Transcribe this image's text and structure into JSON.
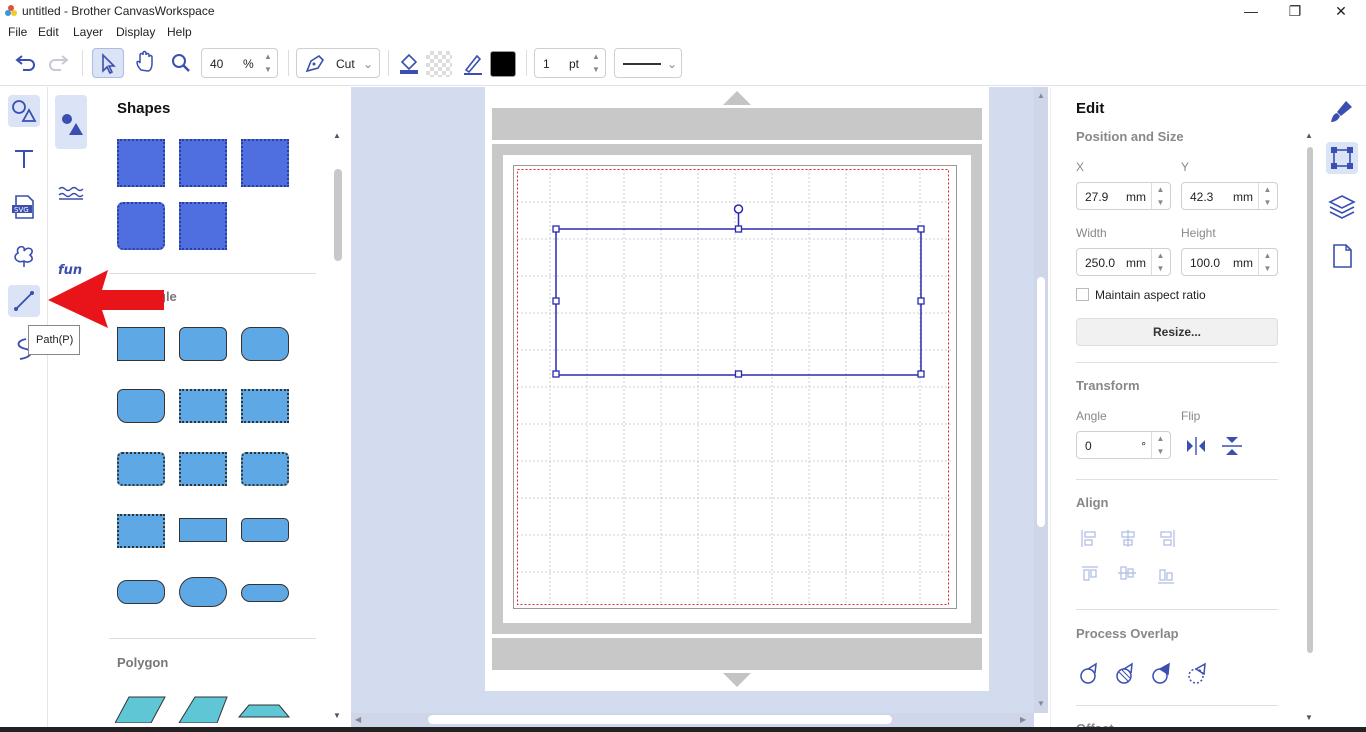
{
  "window": {
    "title": "untitled - Brother CanvasWorkspace"
  },
  "menu": [
    "File",
    "Edit",
    "Layer",
    "Display",
    "Help"
  ],
  "toolbar": {
    "zoom_value": "40",
    "zoom_unit": "%",
    "mode_label": "Cut",
    "stroke_width": "1",
    "stroke_unit": "pt"
  },
  "tooltip": {
    "text": "Path(P)"
  },
  "shapes_panel": {
    "title": "Shapes",
    "section_rect_partial": "gle",
    "section_polygon": "Polygon"
  },
  "edit_panel": {
    "title": "Edit",
    "position_size": "Position and Size",
    "x_label": "X",
    "y_label": "Y",
    "x_value": "27.9",
    "y_value": "42.3",
    "width_label": "Width",
    "height_label": "Height",
    "width_value": "250.0",
    "height_value": "100.0",
    "unit": "mm",
    "aspect_label": "Maintain aspect ratio",
    "resize_label": "Resize...",
    "transform": "Transform",
    "angle_label": "Angle",
    "flip_label": "Flip",
    "angle_value": "0",
    "angle_unit": "°",
    "align": "Align",
    "process_overlap": "Process Overlap",
    "offset": "Offset"
  },
  "colors": {
    "accent": "#3a4fb0",
    "shape_blue": "#4f6fe0",
    "shape_light": "#5ea8e6",
    "polygon": "#5fc6d6",
    "canvas_bg": "#d3dbef",
    "arrow": "#e8141a"
  }
}
